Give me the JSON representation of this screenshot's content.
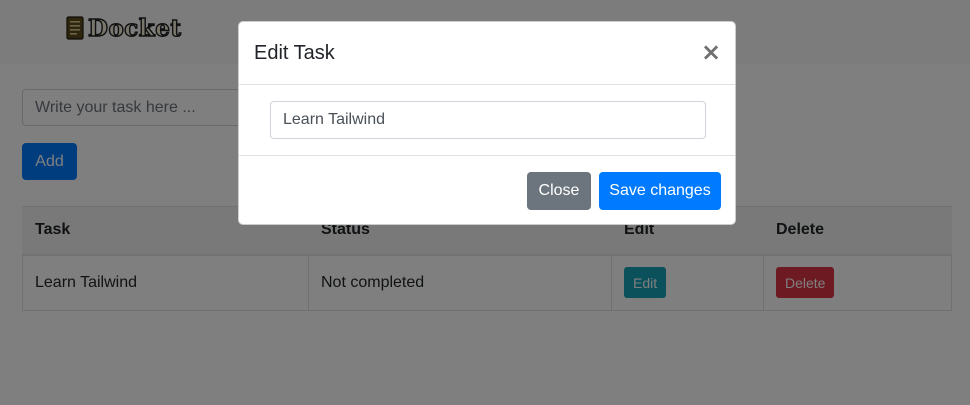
{
  "navbar": {
    "logo_text": "Docket",
    "logo_icon": "notebook-icon"
  },
  "task_form": {
    "placeholder": "Write your task here ...",
    "value": "",
    "add_label": "Add"
  },
  "table": {
    "headers": [
      "Task",
      "Status",
      "Edit",
      "Delete"
    ],
    "rows": [
      {
        "task": "Learn Tailwind",
        "status": "Not completed",
        "edit_label": "Edit",
        "delete_label": "Delete"
      }
    ]
  },
  "modal": {
    "title": "Edit Task",
    "close_icon": "close-icon",
    "close_glyph": "×",
    "input_value": "Learn Tailwind",
    "close_label": "Close",
    "save_label": "Save changes"
  },
  "colors": {
    "primary": "#007bff",
    "secondary": "#6c757d",
    "info": "#17a2b8",
    "danger": "#dc3545"
  }
}
